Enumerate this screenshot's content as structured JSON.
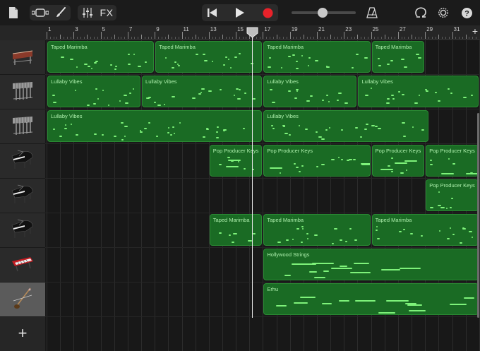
{
  "toolbar": {
    "fx_label": "FX",
    "volume_level": 0.48
  },
  "ruler": {
    "bars": [
      "1",
      "3",
      "5",
      "7",
      "9",
      "11",
      "13",
      "15",
      "17",
      "19",
      "21",
      "23",
      "25",
      "27",
      "29",
      "31"
    ],
    "add_label": "+"
  },
  "tracks": [
    {
      "icon": "marimba-icon"
    },
    {
      "icon": "vibraphone-icon"
    },
    {
      "icon": "vibraphone-icon"
    },
    {
      "icon": "grand-piano-icon"
    },
    {
      "icon": "grand-piano-icon"
    },
    {
      "icon": "grand-piano-icon"
    },
    {
      "icon": "synth-keyboard-icon"
    },
    {
      "icon": "erhu-icon",
      "selected": true
    }
  ],
  "add_track_label": "+",
  "regions": [
    {
      "lane": 0,
      "start": 1,
      "end": 9,
      "label": "Taped Marimba"
    },
    {
      "lane": 0,
      "start": 9,
      "end": 17,
      "label": "Taped Marimba"
    },
    {
      "lane": 0,
      "start": 17,
      "end": 25,
      "label": "Taped Marimba"
    },
    {
      "lane": 0,
      "start": 25,
      "end": 29,
      "label": "Taped Marimba"
    },
    {
      "lane": 1,
      "start": 1,
      "end": 8,
      "label": "Lullaby Vibes"
    },
    {
      "lane": 1,
      "start": 8,
      "end": 17,
      "label": "Lullaby Vibes"
    },
    {
      "lane": 1,
      "start": 17,
      "end": 24,
      "label": "Lullaby Vibes"
    },
    {
      "lane": 1,
      "start": 24,
      "end": 33,
      "label": "Lullaby Vibes"
    },
    {
      "lane": 2,
      "start": 1,
      "end": 17,
      "label": "Lullaby Vibes"
    },
    {
      "lane": 2,
      "start": 17,
      "end": 29.3,
      "label": "Lullaby Vibes"
    },
    {
      "lane": 3,
      "start": 13,
      "end": 17,
      "label": "Pop Producer Keys"
    },
    {
      "lane": 3,
      "start": 17,
      "end": 25,
      "label": "Pop Producer Keys"
    },
    {
      "lane": 3,
      "start": 25,
      "end": 29,
      "label": "Pop Producer Keys"
    },
    {
      "lane": 3,
      "start": 29,
      "end": 33,
      "label": "Pop Producer Keys"
    },
    {
      "lane": 4,
      "start": 29,
      "end": 33,
      "label": "Pop Producer Keys"
    },
    {
      "lane": 5,
      "start": 13,
      "end": 17,
      "label": "Taped Marimba"
    },
    {
      "lane": 5,
      "start": 17,
      "end": 25,
      "label": "Taped Marimba"
    },
    {
      "lane": 5,
      "start": 25,
      "end": 33,
      "label": "Taped Marimba"
    },
    {
      "lane": 6,
      "start": 17,
      "end": 33,
      "label": "Hollywood Strings"
    },
    {
      "lane": 7,
      "start": 17,
      "end": 33,
      "label": "Erhu"
    }
  ],
  "playhead_bar": 16.2,
  "colors": {
    "region": "#1a6b24",
    "note": "#7ef27a",
    "record": "#e8222a"
  }
}
